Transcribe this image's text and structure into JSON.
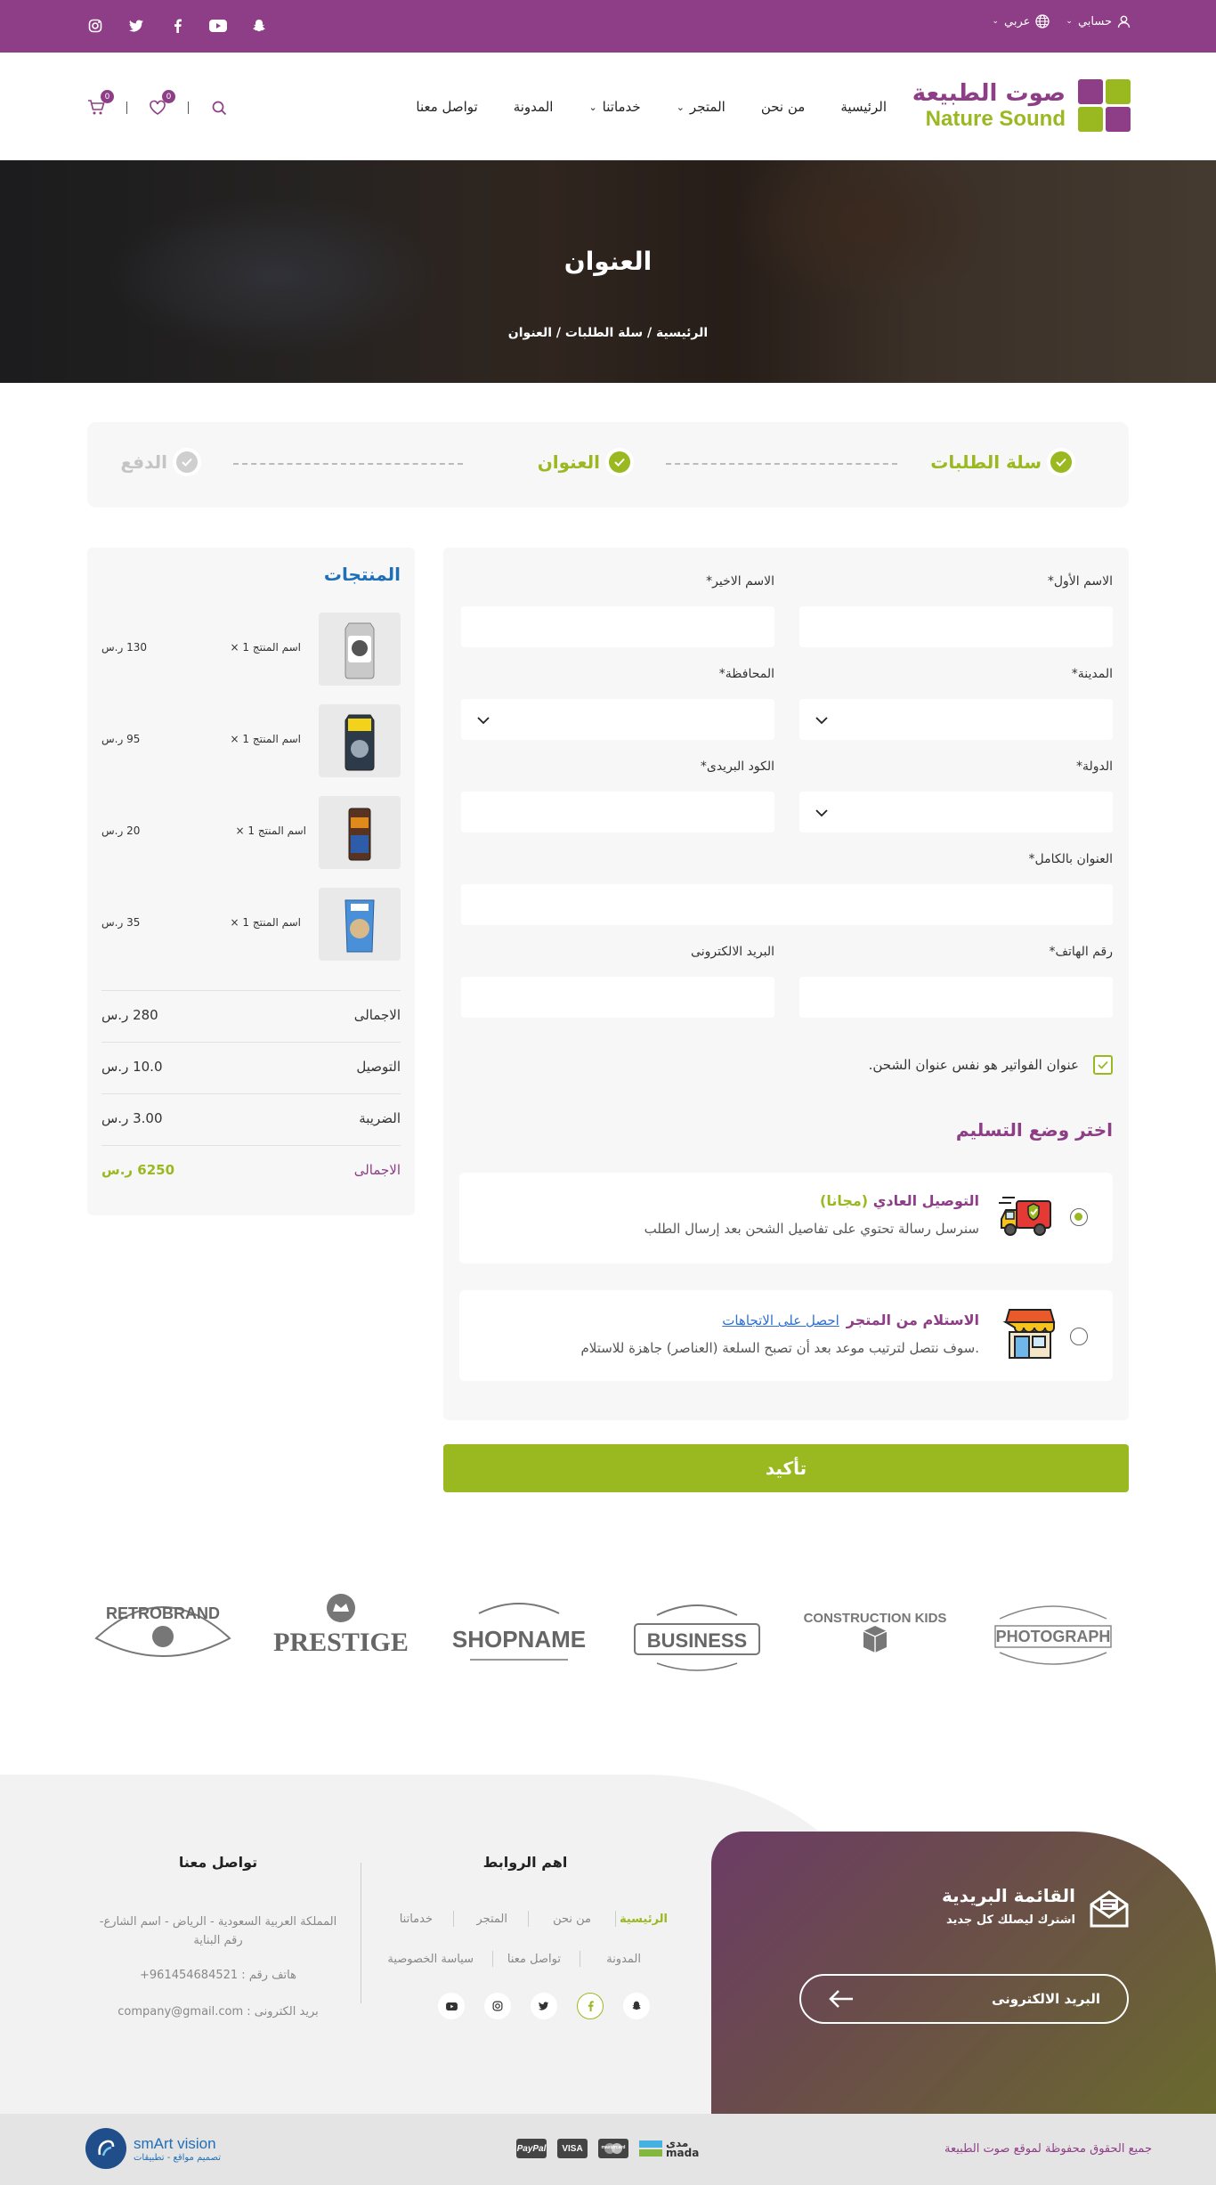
{
  "topbar": {
    "account_label": "حسابي",
    "language_label": "عربي",
    "social": [
      "instagram-icon",
      "twitter-icon",
      "facebook-icon",
      "youtube-icon",
      "snapchat-icon"
    ]
  },
  "brand": {
    "name_ar": "صوت الطبيعة",
    "name_en": "Nature Sound",
    "primary_color": "#8e3e86",
    "accent_color": "#9ab921"
  },
  "nav": {
    "items": [
      "الرئيسية",
      "من نحن",
      "المتجر",
      "خدماتنا",
      "المدونة",
      "تواصل معنا"
    ],
    "wishlist_count": "0",
    "cart_count": "0"
  },
  "hero": {
    "title": "العنوان",
    "breadcrumb": "الرئيسية / سلة الطلبات / العنوان"
  },
  "steps": {
    "cart": "سلة الطلبات",
    "address": "العنوان",
    "payment": "الدفع"
  },
  "form": {
    "first_name": "الاسم الأول*",
    "last_name": "الاسم الاخير*",
    "city": "المدينة*",
    "governorate": "المحافظة*",
    "country": "الدولة*",
    "postal_code": "الكود البريدى*",
    "full_address": "العنوان بالكامل*",
    "phone": "رقم الهاتف*",
    "email": "البريد الالكترونى",
    "same_billing": "عنوان الفواتير هو نفس عنوان الشحن.",
    "delivery_title": "اختر وضع التسليم",
    "option1_title": "التوصيل العادي",
    "option1_free": "(مجانا)",
    "option1_desc": "سنرسل رسالة تحتوي على تفاصيل الشحن بعد إرسال الطلب",
    "option2_title": "الاستلام من المتجر",
    "option2_link": "احصل على الاتجاهات",
    "option2_desc": ".سوف نتصل لترتيب موعد بعد أن تصبح السلعة (العناصر) جاهزة للاستلام",
    "confirm": "تأكيد"
  },
  "summary": {
    "title": "المنتجات",
    "products": [
      {
        "name": "اسم المنتج",
        "qty": "1  ×",
        "price": "130 ر.س"
      },
      {
        "name": "اسم المنتج",
        "qty": "1  ×",
        "price": "95 ر.س"
      },
      {
        "name": "اسم المنتج",
        "qty": "1  ×",
        "price": "20 ر.س"
      },
      {
        "name": "اسم المنتج",
        "qty": "1  ×",
        "price": "35 ر.س"
      }
    ],
    "rows": [
      {
        "label": "الاجمالى",
        "value": "280 ر.س"
      },
      {
        "label": "التوصيل",
        "value": "10.0 ر.س"
      },
      {
        "label": "الضريبة",
        "value": "3.00 ر.س"
      },
      {
        "label": "الاجمالى",
        "value": "6250 ر.س"
      }
    ]
  },
  "brands": [
    "PHOTOGRAPH",
    "CONSTRUCTION KIDS",
    "BUSINESS",
    "SHOPNAME",
    "PRESTIGE",
    "RETROBRAND"
  ],
  "footer": {
    "newsletter_title": "القائمة البريدية",
    "newsletter_sub": "اشترك ليصلك كل جديد",
    "newsletter_placeholder": "البريد الالكترونى",
    "links_title": "اهم الروابط",
    "links": [
      "الرئيسية",
      "من نحن",
      "المتجر",
      "خدماتنا",
      "المدونة",
      "تواصل معنا",
      "سياسة الخصوصية"
    ],
    "contact_title": "تواصل معنا",
    "address": "المملكة العربية السعودية - الرياض - اسم الشارع- رقم البناية",
    "phone": "هاتف رقم : 961454684521+",
    "email": "بريد الكترونى : company@gmail.com",
    "copyright": "جميع الحقوق محفوظة لموقع صوت الطبيعة",
    "payments": [
      "PayPal",
      "VISA",
      "mastercard",
      "mada"
    ],
    "mada_ar": "مدى",
    "developer": "smArt vision",
    "developer_sub": "تصميم مواقع - تطبيقات"
  }
}
